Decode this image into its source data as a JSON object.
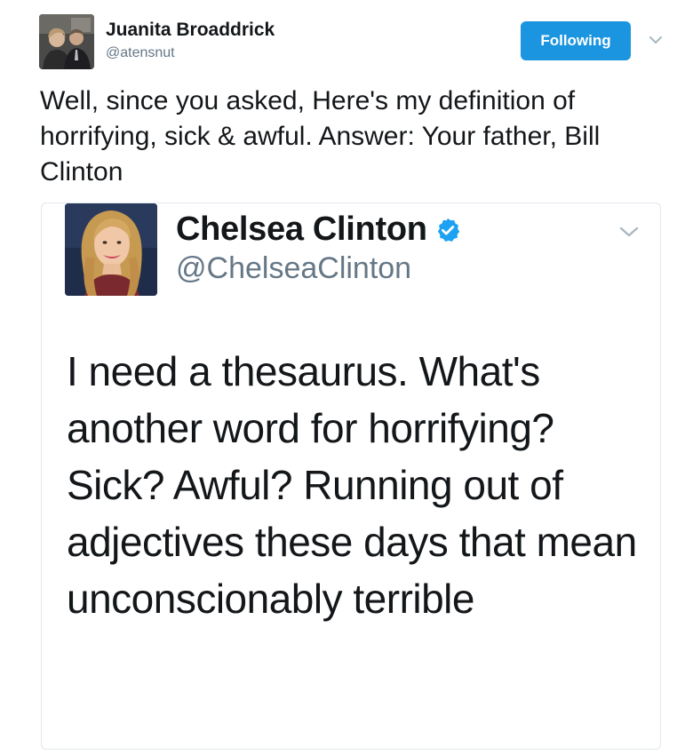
{
  "tweet": {
    "author": {
      "display_name": "Juanita Broaddrick",
      "handle": "@atensnut"
    },
    "follow_button_label": "Following",
    "text": "Well, since you asked, Here's my definition of horrifying, sick & awful. Answer: Your father, Bill Clinton"
  },
  "quoted_tweet": {
    "author": {
      "display_name": "Chelsea Clinton",
      "handle": "@ChelseaClinton",
      "verified": true
    },
    "text": "I need a thesaurus. What's another word for horrifying? Sick? Awful? Running out of adjectives these days that mean unconscionably terrible"
  },
  "icons": {
    "more_menu": "chevron-down-icon",
    "verified": "verified-badge-icon"
  },
  "colors": {
    "accent": "#1b95e0",
    "text_primary": "#14171a",
    "text_secondary": "#657786",
    "border": "#e1e8ed"
  }
}
